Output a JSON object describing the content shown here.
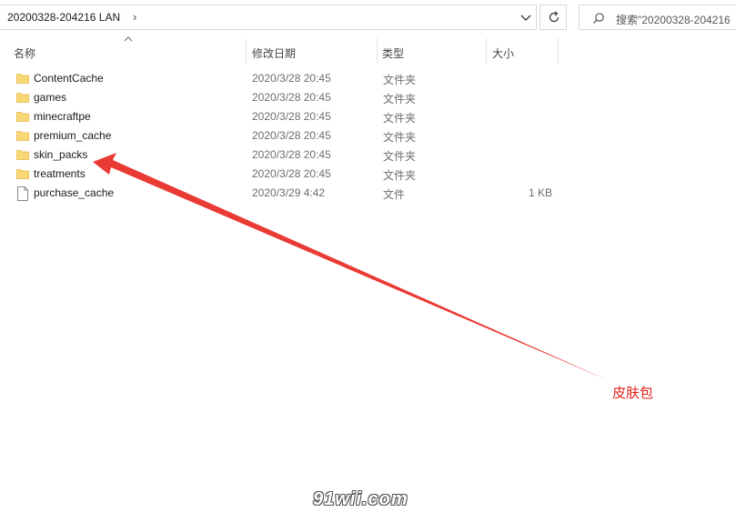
{
  "address_bar": {
    "path": "20200328-204216 LAN",
    "separator": "›"
  },
  "search": {
    "placeholder": "搜索\"20200328-204216"
  },
  "columns": {
    "name": "名称",
    "date": "修改日期",
    "type": "类型",
    "size": "大小"
  },
  "files": [
    {
      "name": "ContentCache",
      "date": "2020/3/28 20:45",
      "type": "文件夹",
      "size": "",
      "icon": "folder-icon"
    },
    {
      "name": "games",
      "date": "2020/3/28 20:45",
      "type": "文件夹",
      "size": "",
      "icon": "folder-icon"
    },
    {
      "name": "minecraftpe",
      "date": "2020/3/28 20:45",
      "type": "文件夹",
      "size": "",
      "icon": "folder-icon"
    },
    {
      "name": "premium_cache",
      "date": "2020/3/28 20:45",
      "type": "文件夹",
      "size": "",
      "icon": "folder-icon"
    },
    {
      "name": "skin_packs",
      "date": "2020/3/28 20:45",
      "type": "文件夹",
      "size": "",
      "icon": "folder-icon"
    },
    {
      "name": "treatments",
      "date": "2020/3/28 20:45",
      "type": "文件夹",
      "size": "",
      "icon": "folder-icon"
    },
    {
      "name": "purchase_cache",
      "date": "2020/3/29 4:42",
      "type": "文件",
      "size": "1 KB",
      "icon": "file-icon"
    }
  ],
  "annotation": {
    "label": "皮肤包",
    "color": "#e2211c"
  },
  "watermark": "91wii.com",
  "colors": {
    "folder": "#f8d775",
    "folder_tab": "#e8b84a",
    "border": "#d9d9d9"
  }
}
